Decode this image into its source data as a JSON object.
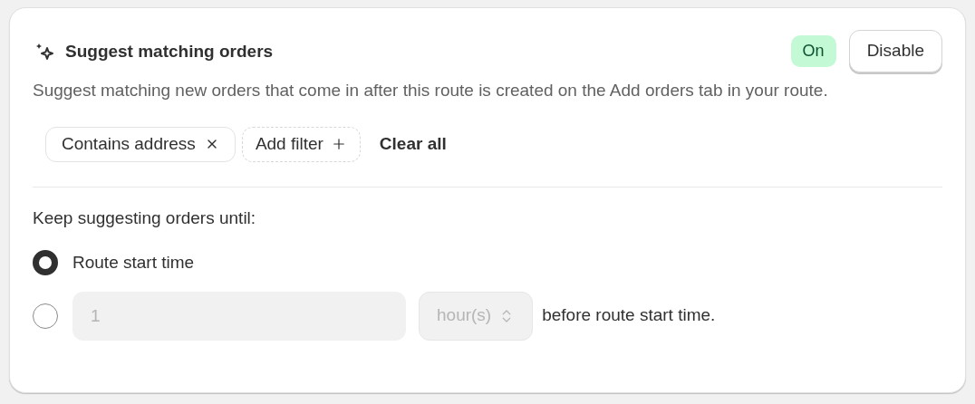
{
  "card": {
    "title": "Suggest matching orders",
    "status": {
      "label": "On",
      "on": true
    },
    "disable_button": "Disable",
    "description": "Suggest matching new orders that come in after this route is created on the Add orders tab in your route.",
    "filters": [
      {
        "kind": "applied",
        "label": "Contains address"
      },
      {
        "kind": "add",
        "label": "Add filter"
      }
    ],
    "clear_all": "Clear all"
  },
  "until": {
    "label": "Keep suggesting orders until:",
    "options": [
      {
        "kind": "text",
        "label": "Route start time",
        "selected": true
      },
      {
        "kind": "offset",
        "value": "1",
        "unit": "hour(s)",
        "suffix": "before route start time.",
        "disabled": true,
        "selected": false
      }
    ]
  }
}
